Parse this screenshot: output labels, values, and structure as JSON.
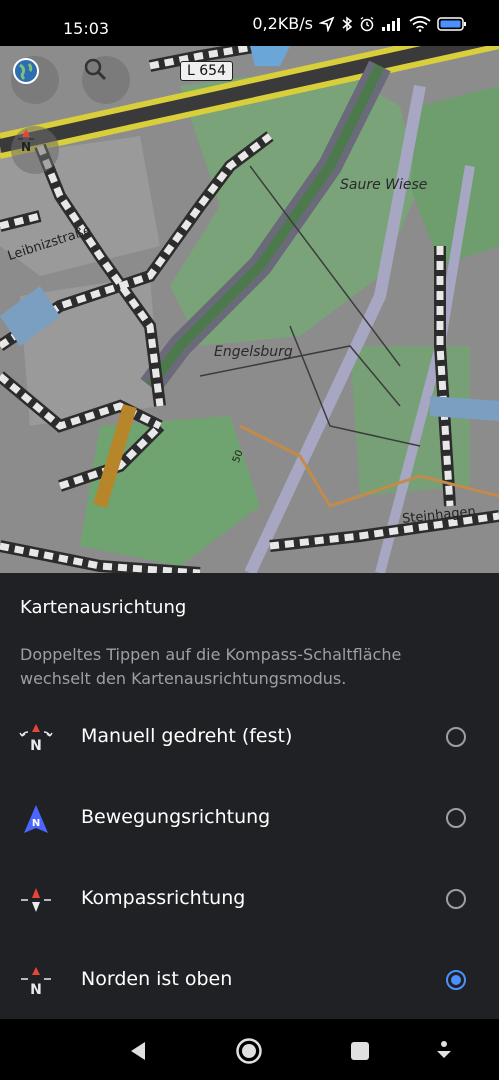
{
  "status_bar": {
    "time": "15:03",
    "network_speed": "0,2KB/s",
    "icons": [
      "location-arrow-icon",
      "bluetooth-icon",
      "alarm-icon",
      "signal-icon",
      "wifi-icon",
      "battery-icon"
    ]
  },
  "map": {
    "road_shield": "L 654",
    "place_labels": [
      "Saure Wiese",
      "Engelsburg"
    ],
    "street_labels": [
      "Leibnizstraße",
      "Steinhagen",
      "50"
    ],
    "buttons": [
      "layers-globe-icon",
      "search-icon",
      "compass-icon"
    ]
  },
  "sheet": {
    "title": "Kartenausrichtung",
    "description": "Doppeltes Tippen auf die Kompass-Schaltfläche wechselt den Kartenausrichtungsmodus.",
    "options": [
      {
        "label": "Manuell gedreht (fest)",
        "icon": "manual-rotation-icon",
        "selected": false
      },
      {
        "label": "Bewegungsrichtung",
        "icon": "movement-direction-icon",
        "selected": false
      },
      {
        "label": "Kompassrichtung",
        "icon": "compass-direction-icon",
        "selected": false
      },
      {
        "label": "Norden ist oben",
        "icon": "north-up-icon",
        "selected": true
      }
    ]
  },
  "navbar": {
    "buttons": [
      "back-icon",
      "home-icon",
      "recents-icon",
      "keyboard-hide-icon"
    ]
  },
  "colors": {
    "accent": "#4a90ff",
    "sheet_bg": "#202124",
    "secondary_text": "#9aa0a6"
  }
}
